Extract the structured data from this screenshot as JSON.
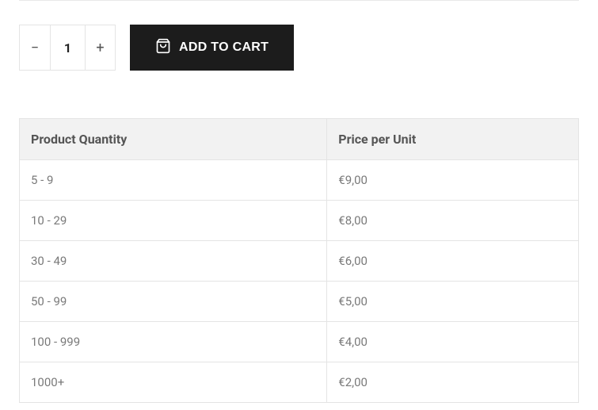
{
  "quantity": {
    "minus": "−",
    "value": "1",
    "plus": "+"
  },
  "addToCart": "ADD TO CART",
  "table": {
    "headers": {
      "quantity": "Product Quantity",
      "price": "Price per Unit"
    },
    "rows": [
      {
        "qty": "5 - 9",
        "price": "€9,00"
      },
      {
        "qty": "10 - 29",
        "price": "€8,00"
      },
      {
        "qty": "30 - 49",
        "price": "€6,00"
      },
      {
        "qty": "50 - 99",
        "price": "€5,00"
      },
      {
        "qty": "100 - 999",
        "price": "€4,00"
      },
      {
        "qty": "1000+",
        "price": "€2,00"
      }
    ]
  }
}
